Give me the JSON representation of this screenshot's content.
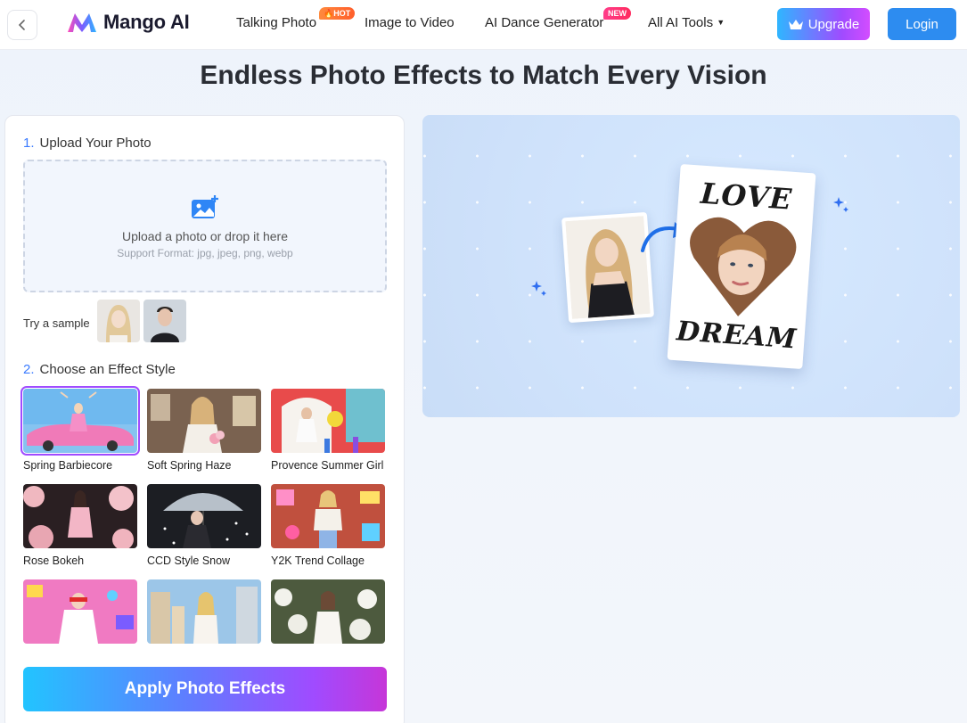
{
  "app": {
    "name": "Mango AI"
  },
  "nav": {
    "items": [
      {
        "label": "Talking Photo",
        "badge": "HOT"
      },
      {
        "label": "Image to Video",
        "badge": ""
      },
      {
        "label": "AI Dance Generator",
        "badge": "NEW"
      },
      {
        "label": "All AI Tools",
        "badge": ""
      }
    ],
    "upgrade_label": "Upgrade",
    "login_label": "Login"
  },
  "page": {
    "title": "Endless Photo Effects to Match Every Vision"
  },
  "upload": {
    "step_number": "1.",
    "step_title": "Upload Your Photo",
    "main_text": "Upload a photo or drop it here",
    "sub_text": "Support Format: jpg, jpeg, png, webp",
    "sample_label": "Try a sample"
  },
  "effects": {
    "step_number": "2.",
    "step_title": "Choose an Effect Style",
    "items": [
      {
        "label": "Spring Barbiecore",
        "selected": true
      },
      {
        "label": "Soft Spring Haze",
        "selected": false
      },
      {
        "label": "Provence Summer Girl",
        "selected": false
      },
      {
        "label": "Rose Bokeh",
        "selected": false
      },
      {
        "label": "CCD Style Snow",
        "selected": false
      },
      {
        "label": "Y2K Trend Collage",
        "selected": false
      },
      {
        "label": "",
        "selected": false
      },
      {
        "label": "",
        "selected": false
      },
      {
        "label": "",
        "selected": false
      }
    ]
  },
  "apply_label": "Apply Photo Effects",
  "preview": {
    "top_word": "LOVE",
    "bottom_word": "DREAM"
  },
  "colors": {
    "accent": "#2d8cf0",
    "step_number": "#3b7bff",
    "selected_outline": "#a04bff"
  }
}
